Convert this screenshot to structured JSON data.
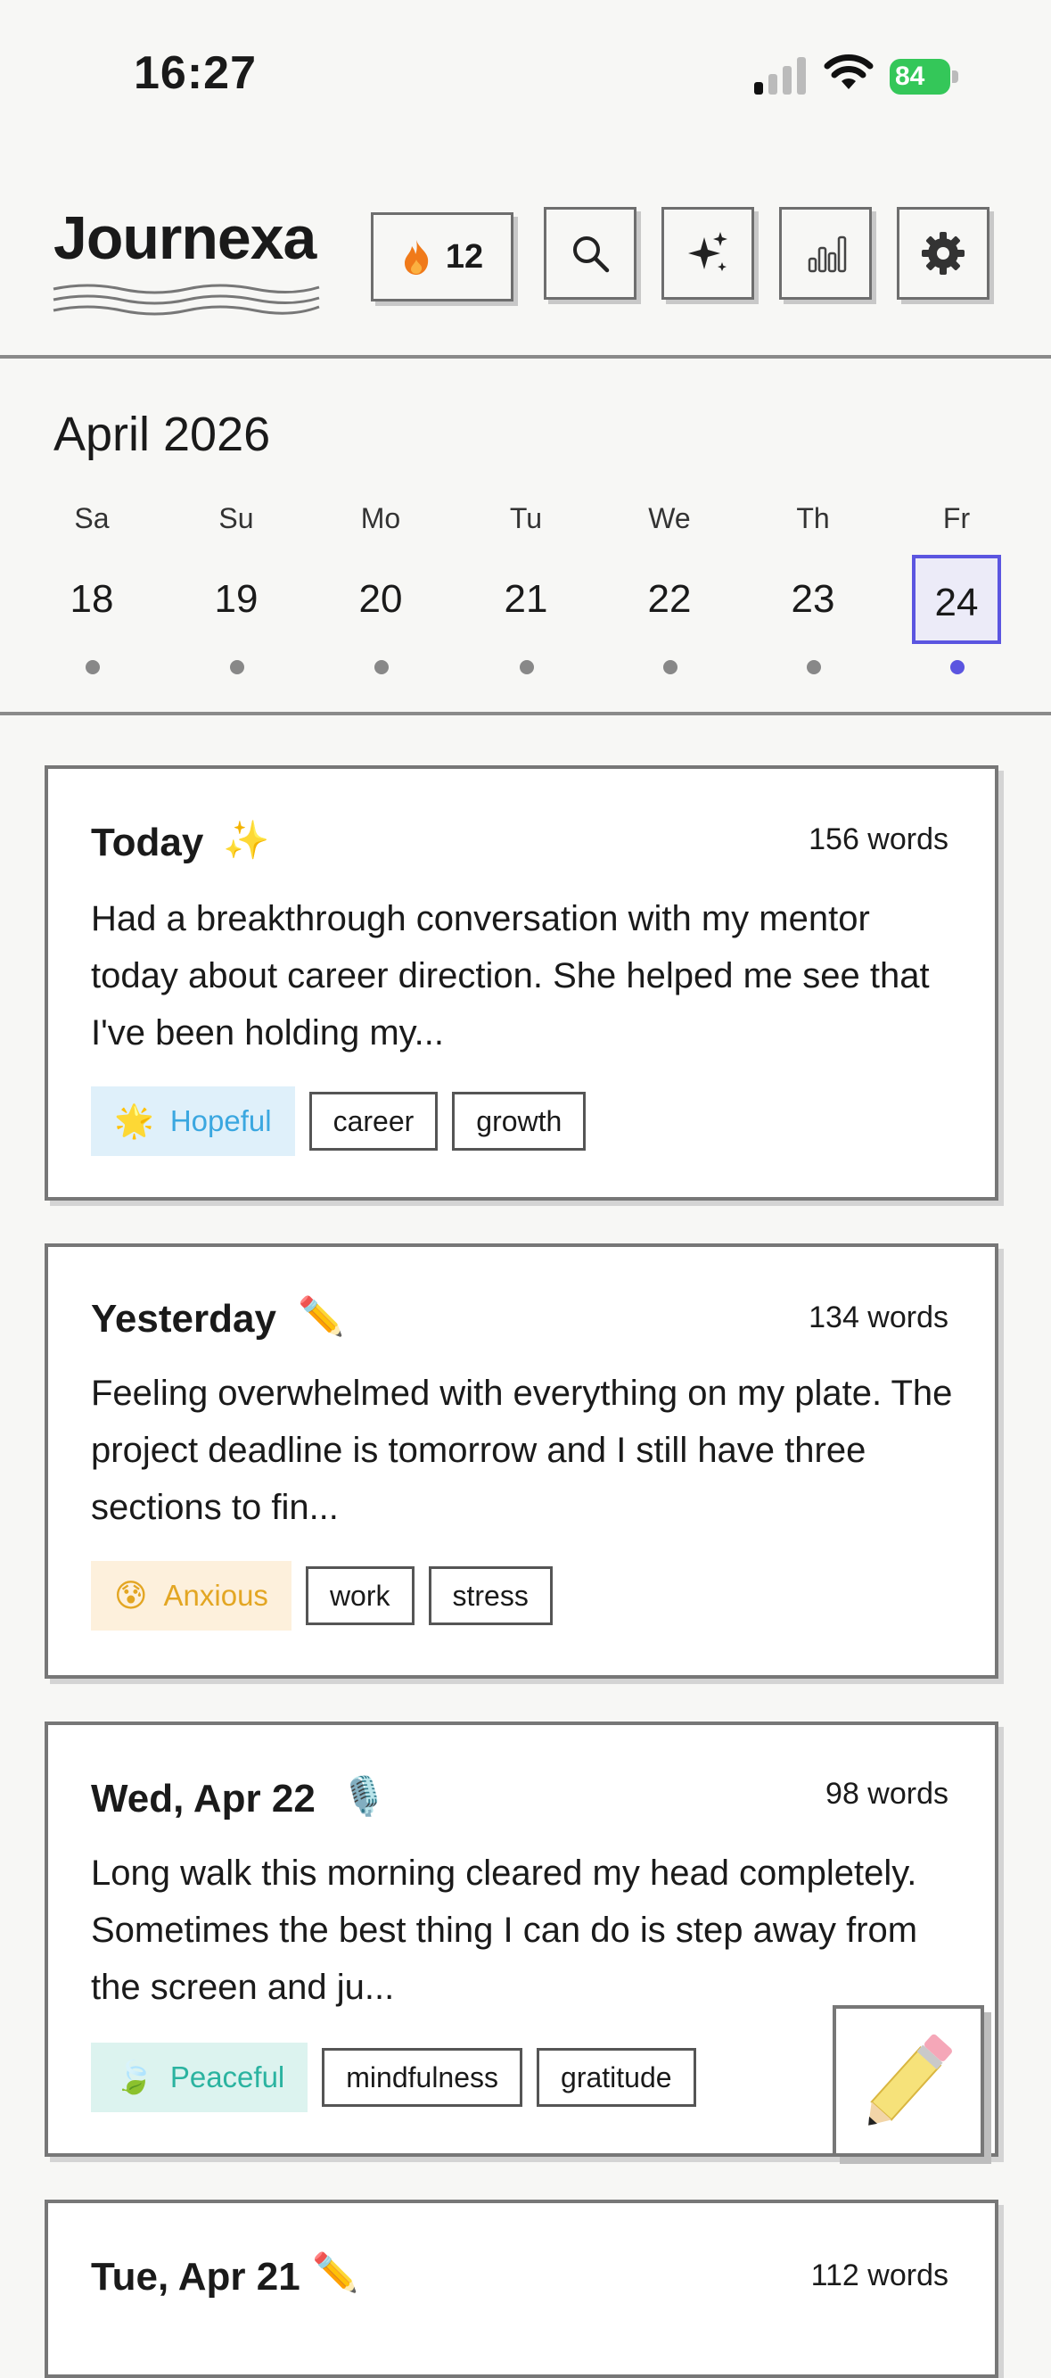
{
  "status_bar": {
    "time": "16:27",
    "battery": "84"
  },
  "header": {
    "app_name": "Journexa",
    "streak_count": "12",
    "buttons": [
      "flame-icon",
      "search-icon",
      "sparkles-icon",
      "stats-icon",
      "gear-icon"
    ]
  },
  "calendar": {
    "month_label": "April 2026",
    "days": [
      {
        "name": "Sa",
        "num": "18"
      },
      {
        "name": "Su",
        "num": "19"
      },
      {
        "name": "Mo",
        "num": "20"
      },
      {
        "name": "Tu",
        "num": "21"
      },
      {
        "name": "We",
        "num": "22"
      },
      {
        "name": "Th",
        "num": "23"
      },
      {
        "name": "Fr",
        "num": "24"
      }
    ],
    "selected": "24",
    "accent_color": "#5b55e0"
  },
  "entries": [
    {
      "title": "Today",
      "emoji": "✨",
      "words": "156 words",
      "preview": "Had a breakthrough conversation with my mentor today about career direction. She helped me see that I've been holding my...",
      "mood": {
        "emoji": "🌟",
        "label": "Hopeful",
        "color": "#3aa7e0",
        "bg": "#dff0fa"
      },
      "tags": [
        "career",
        "growth"
      ]
    },
    {
      "title": "Yesterday",
      "emoji": "✏️",
      "words": "134 words",
      "preview": "Feeling overwhelmed with everything on my plate. The project deadline is tomorrow and I still have three sections to fin...",
      "mood": {
        "emoji": "😰",
        "label": "Anxious",
        "color": "#e3a623",
        "bg": "#fdf0dc"
      },
      "tags": [
        "work",
        "stress"
      ]
    },
    {
      "title": "Wed, Apr 22",
      "emoji": "🎙️",
      "words": "98 words",
      "preview": "Long walk this morning cleared my head completely. Sometimes the best thing I can do is step away from the screen and ju...",
      "mood": {
        "emoji": "🍃",
        "label": "Peaceful",
        "color": "#2bb3a0",
        "bg": "#dcf3ef"
      },
      "tags": [
        "mindfulness",
        "gratitude"
      ]
    },
    {
      "title": "Tue, Apr 21",
      "emoji": "✏️",
      "words": "112 words"
    }
  ],
  "fab": {
    "icon": "pencil-icon"
  }
}
